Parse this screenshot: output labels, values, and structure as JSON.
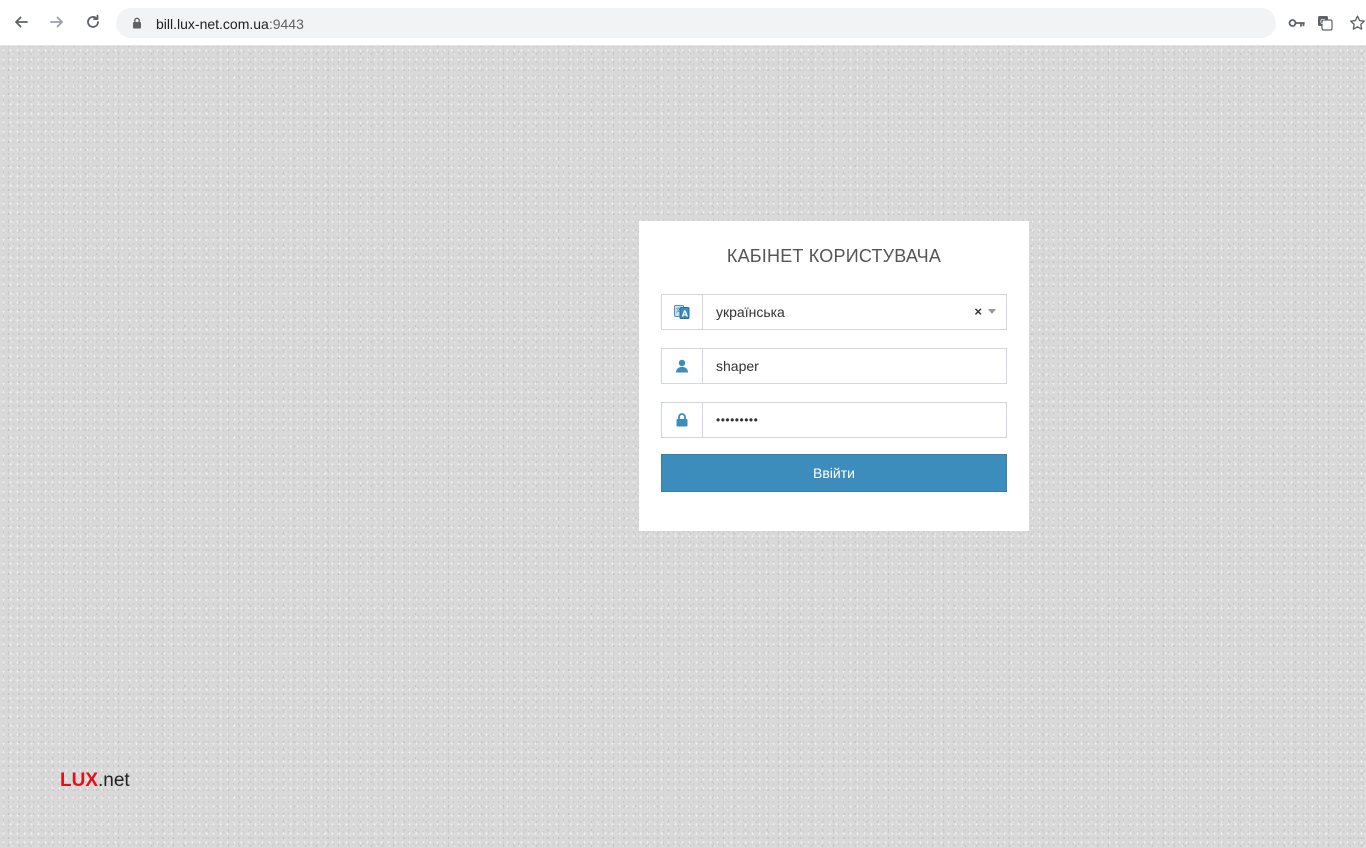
{
  "browser": {
    "url_host": "bill.lux-net.com.ua",
    "url_port": ":9443"
  },
  "login": {
    "title": "КАБІНЕТ КОРИСТУВАЧА",
    "language_value": "українська",
    "clear_symbol": "×",
    "username_value": "shaper",
    "password_value": "shaper123",
    "submit_label": "Ввійти"
  },
  "brand": {
    "strong": "LUX",
    "rest": ".net",
    "strong_color": "#e3121a"
  },
  "colors": {
    "accent": "#3c8dbc",
    "background": "#d9d9d9"
  },
  "icons": {
    "back": "arrow-left-icon",
    "forward": "arrow-right-icon",
    "reload": "reload-icon",
    "lock": "lock-icon",
    "key": "key-icon",
    "translate": "translate-icon",
    "bookmark": "star-icon",
    "language": "language-icon",
    "user": "user-icon",
    "password": "lock-icon"
  }
}
